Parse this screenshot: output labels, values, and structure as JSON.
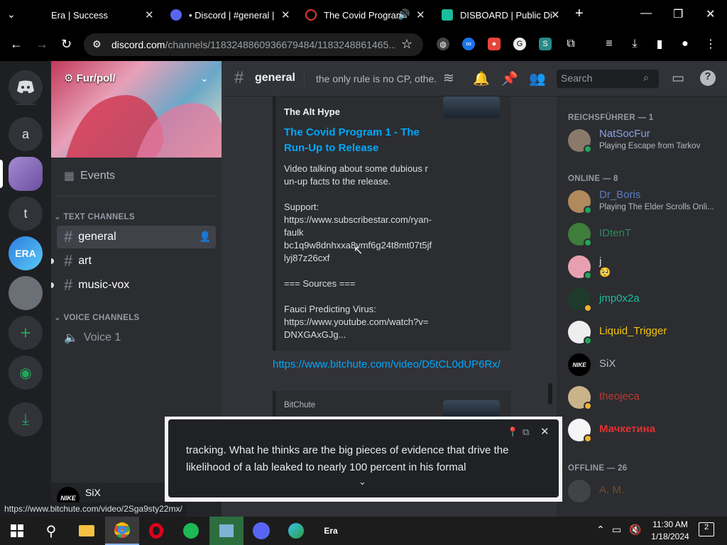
{
  "browser": {
    "tabs": [
      {
        "title": "Era | Success",
        "active": false
      },
      {
        "title": "• Discord | #general | F",
        "active": false
      },
      {
        "title": "The Covid Program",
        "active": true
      },
      {
        "title": "DISBOARD | Public Dis",
        "active": false
      }
    ],
    "new_tab": "+",
    "url_host": "discord.com",
    "url_path": "/channels/1183248860936679484/1183248861465...",
    "status_url": "https://www.bitchute.com/video/2Sga9sty22mx/"
  },
  "rail": {
    "servers": [
      {
        "label": "a"
      },
      {
        "label": "t"
      }
    ]
  },
  "channels": {
    "server_name": "Fur/pol/",
    "events": "Events",
    "text_header": "TEXT CHANNELS",
    "text_channels": [
      {
        "name": "general"
      },
      {
        "name": "art"
      },
      {
        "name": "music-vox"
      }
    ],
    "voice_header": "VOICE CHANNELS",
    "voice_channels": [
      {
        "name": "Voice 1"
      }
    ],
    "user": {
      "name": "SiX"
    }
  },
  "header": {
    "channel": "general",
    "topic": "the only rule is no CP, othe...",
    "search_placeholder": "Search"
  },
  "messages": {
    "embed": {
      "author": "The Alt Hype",
      "title": "The Covid Program 1 - The Run-Up to Release",
      "description": "Video talking about some dubious run-up facts to the release.\n\nSupport:\nhttps://www.subscribestar.com/ryan-faulk\nbc1q9w8dnhxxa8vmf6g24t8mt07t5jflyj87z26cxf\n\n=== Sources ===\n\nFauci Predicting Virus:\nhttps://www.youtube.com/watch?v=DNXGAxGJg..."
    },
    "link": "https://www.bitchute.com/video/D5tCL0dUP6Rx/",
    "embed2_provider": "BitChute"
  },
  "members": {
    "groups": [
      {
        "header": "REICHSFÜHRER — 1",
        "members": [
          {
            "name": "NatSocFur",
            "activity": "Playing Escape from Tarkov",
            "color": "#8ea1e1"
          }
        ]
      },
      {
        "header": "ONLINE — 8",
        "members": [
          {
            "name": "Dr_Boris",
            "activity": "Playing The Elder Scrolls Onli...",
            "color": "#5b7bbf"
          },
          {
            "name": "IDtenT",
            "activity": "",
            "color": "#2e8b57"
          },
          {
            "name": "j",
            "activity": "🥺",
            "color": "#dbdee1"
          },
          {
            "name": "jmp0x2a",
            "activity": "",
            "color": "#1abc9c"
          },
          {
            "name": "Liquid_Trigger",
            "activity": "",
            "color": "#f1c40f"
          },
          {
            "name": "SiX",
            "activity": "",
            "color": "#b5bac1"
          },
          {
            "name": "theojeca",
            "activity": "",
            "color": "#c0392b"
          },
          {
            "name": "Мачкетина",
            "activity": "",
            "color": "#e03131"
          }
        ]
      },
      {
        "header": "OFFLINE — 26",
        "members": [
          {
            "name": "A. M.",
            "activity": "",
            "color": "#e67e22"
          }
        ]
      }
    ]
  },
  "caption": {
    "text": "tracking. What he thinks are the big pieces of evidence that drive the likelihood of a lab leaked to nearly 100 percent in his formal"
  },
  "taskbar": {
    "era_label": "Era",
    "time": "11:30 AM",
    "date": "1/18/2024",
    "notifications": "2"
  }
}
